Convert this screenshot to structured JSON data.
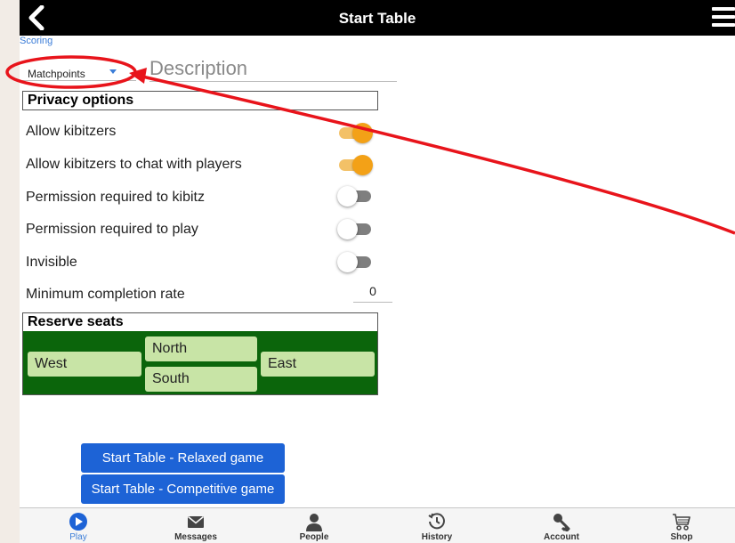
{
  "header": {
    "title": "Start Table"
  },
  "scoring": {
    "label": "Scoring",
    "selected": "Matchpoints"
  },
  "description": {
    "placeholder": "Description",
    "value": ""
  },
  "privacy": {
    "heading": "Privacy options",
    "options": [
      {
        "label": "Allow kibitzers",
        "on": true
      },
      {
        "label": "Allow kibitzers to chat with players",
        "on": true
      },
      {
        "label": "Permission required to kibitz",
        "on": false
      },
      {
        "label": "Permission required to play",
        "on": false
      },
      {
        "label": "Invisible",
        "on": false
      }
    ],
    "min_completion": {
      "label": "Minimum completion rate",
      "value": "0"
    }
  },
  "reserve": {
    "heading": "Reserve seats",
    "north": "North",
    "south": "South",
    "west": "West",
    "east": "East"
  },
  "buttons": {
    "relaxed": "Start Table - Relaxed game",
    "competitive": "Start Table - Competitive game"
  },
  "nav": [
    {
      "label": "Play",
      "icon": "play-icon",
      "active": true
    },
    {
      "label": "Messages",
      "icon": "envelope-icon",
      "active": false
    },
    {
      "label": "People",
      "icon": "person-icon",
      "active": false
    },
    {
      "label": "History",
      "icon": "history-icon",
      "active": false
    },
    {
      "label": "Account",
      "icon": "key-icon",
      "active": false
    },
    {
      "label": "Shop",
      "icon": "cart-icon",
      "active": false
    }
  ],
  "colors": {
    "accent_blue": "#1d63d6",
    "toggle_on": "#f3a117",
    "seat_bg": "#0b650b",
    "annotation_red": "#e8141b"
  }
}
